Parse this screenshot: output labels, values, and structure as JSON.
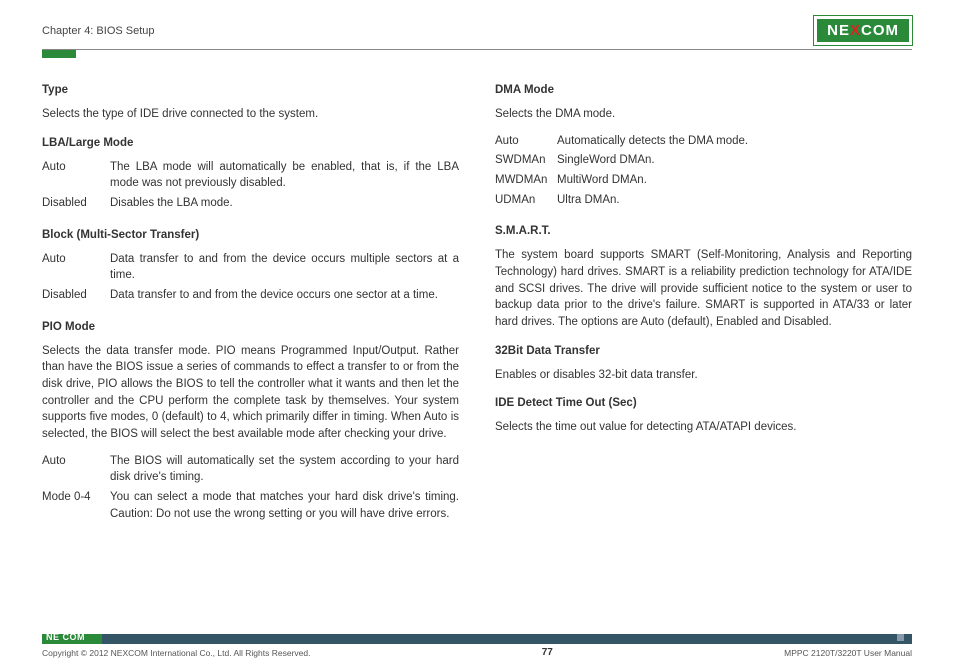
{
  "header": {
    "chapter": "Chapter 4: BIOS Setup",
    "logo_pre": "NE",
    "logo_x": "X",
    "logo_post": "COM"
  },
  "left": {
    "type_h": "Type",
    "type_p": "Selects the type of IDE drive connected to the system.",
    "lba_h": "LBA/Large Mode",
    "lba_rows": [
      [
        "Auto",
        "The LBA mode will automatically be enabled, that is, if the LBA mode was not previously disabled."
      ],
      [
        "Disabled",
        "Disables the LBA mode."
      ]
    ],
    "block_h": "Block (Multi-Sector Transfer)",
    "block_rows": [
      [
        "Auto",
        "Data transfer to and from the device occurs multiple sectors at a time."
      ],
      [
        "Disabled",
        "Data transfer to and from the device occurs one sector at a time."
      ]
    ],
    "pio_h": "PIO Mode",
    "pio_p": "Selects the data transfer mode. PIO means Programmed Input/Output. Rather than have the BIOS issue a series of commands to effect a transfer to or from the disk drive, PIO allows the BIOS to tell the controller what it wants and then let the controller and the CPU perform the complete task by themselves. Your system supports five modes, 0 (default) to 4, which primarily differ in timing. When Auto is selected, the BIOS will select the best available mode after checking your drive.",
    "pio_rows": [
      [
        "Auto",
        "The BIOS will automatically set the system according to your hard disk drive's timing."
      ],
      [
        "Mode 0-4",
        "You can select a mode that matches your hard disk drive's timing. Caution: Do not use the wrong setting or you will have drive errors."
      ]
    ]
  },
  "right": {
    "dma_h": "DMA Mode",
    "dma_p": "Selects the DMA mode.",
    "dma_rows": [
      [
        "Auto",
        "Automatically detects the DMA mode."
      ],
      [
        "SWDMAn",
        "SingleWord DMAn."
      ],
      [
        "MWDMAn",
        "MultiWord DMAn."
      ],
      [
        "UDMAn",
        "Ultra DMAn."
      ]
    ],
    "smart_h": "S.M.A.R.T.",
    "smart_p": "The system board supports SMART (Self-Monitoring, Analysis and Reporting Technology) hard drives. SMART is a reliability prediction technology for ATA/IDE and SCSI drives. The drive will provide sufficient notice to the system or user to backup data prior to the drive's failure. SMART is supported in ATA/33 or later hard drives. The options are Auto (default), Enabled and Disabled.",
    "bit32_h": "32Bit Data Transfer",
    "bit32_p": "Enables or disables 32-bit data transfer.",
    "ide_h": "IDE Detect Time Out (Sec)",
    "ide_p": "Selects the time out value for detecting ATA/ATAPI devices."
  },
  "footer": {
    "copyright": "Copyright © 2012 NEXCOM International Co., Ltd. All Rights Reserved.",
    "page": "77",
    "manual": "MPPC 2120T/3220T User Manual",
    "logo": "NE COM"
  }
}
